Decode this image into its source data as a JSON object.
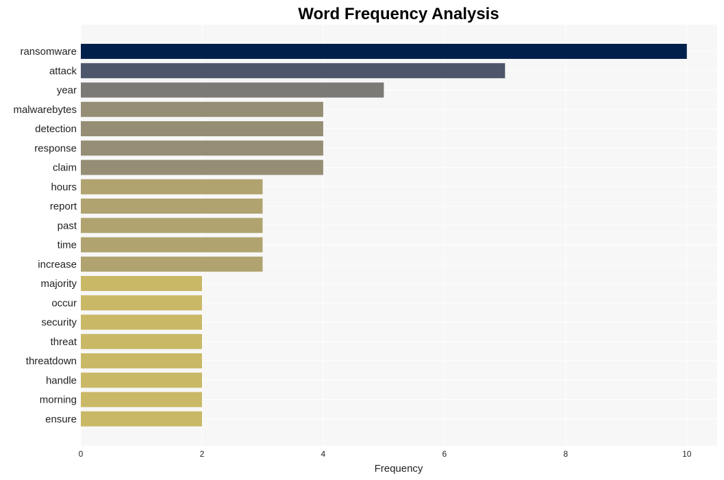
{
  "chart_data": {
    "type": "bar",
    "orientation": "horizontal",
    "title": "Word Frequency Analysis",
    "xlabel": "Frequency",
    "ylabel": "",
    "xlim": [
      0,
      10.5
    ],
    "xticks": [
      0,
      2,
      4,
      6,
      8,
      10
    ],
    "grid": true,
    "categories": [
      "ransomware",
      "attack",
      "year",
      "malwarebytes",
      "detection",
      "response",
      "claim",
      "hours",
      "report",
      "past",
      "time",
      "increase",
      "majority",
      "occur",
      "security",
      "threat",
      "threatdown",
      "handle",
      "morning",
      "ensure"
    ],
    "values": [
      10,
      7,
      5,
      4,
      4,
      4,
      4,
      3,
      3,
      3,
      3,
      3,
      2,
      2,
      2,
      2,
      2,
      2,
      2,
      2
    ],
    "colors": [
      "#00204c",
      "#4e566c",
      "#7b7a77",
      "#958e75",
      "#958e75",
      "#958e75",
      "#958e75",
      "#b0a36f",
      "#b0a36f",
      "#b0a36f",
      "#b0a36f",
      "#b0a36f",
      "#c9b866",
      "#c9b866",
      "#c9b866",
      "#c9b866",
      "#c9b866",
      "#c9b866",
      "#c9b866",
      "#c9b866"
    ],
    "plot_background": "#f7f7f7",
    "grid_color": "#ffffff"
  }
}
